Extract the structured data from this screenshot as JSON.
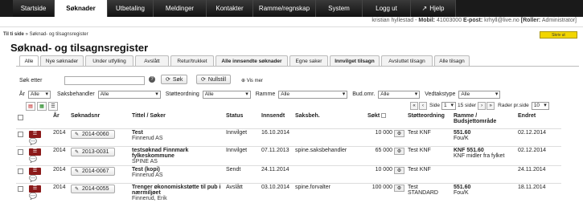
{
  "nav": {
    "tabs": [
      "Startside",
      "Søknader",
      "Utbetaling",
      "Meldinger",
      "Kontakter",
      "Ramme/regnskap",
      "System",
      "Logg ut",
      "Hjelp"
    ],
    "active": "Søknader"
  },
  "user": {
    "name": "kristian hyllestad",
    "mobile_label": "Mobil:",
    "mobile": "41003000",
    "email_label": "E-post:",
    "email": "krhyll@live.no",
    "roles_label": "[Roller:",
    "roles": "Administrator]"
  },
  "breadcrumb": {
    "home": "Til ti side",
    "sep": "»",
    "current": "Søknad- og tilsagnsregister"
  },
  "yellow_button": "Skriv ut",
  "page_title": "Søknad- og tilsagnsregister",
  "tabs": [
    "Alle",
    "Nye søknader",
    "Under utfylling",
    "Avslått",
    "Retur/trukket",
    "Alle innsendte søknader",
    "Egne saker",
    "Innvilget tilsagn",
    "Avsluttet tilsagn",
    "Alle tilsagn"
  ],
  "search": {
    "label": "Søk etter",
    "value": "",
    "search_button": "Søk",
    "reset_button": "Nullstill",
    "more": "Vis mer"
  },
  "filters": [
    {
      "label": "År",
      "value": "Alle"
    },
    {
      "label": "Saksbehandler",
      "value": "Alle"
    },
    {
      "label": "Støtteordning",
      "value": "Alle"
    },
    {
      "label": "Ramme",
      "value": "Alle"
    },
    {
      "label": "Bud.omr.",
      "value": "Alle"
    },
    {
      "label": "Vedtakstype",
      "value": "Alle"
    }
  ],
  "pager": {
    "page_label": "Side",
    "page": "1",
    "of": "15 sider",
    "rows_label": "Rader pr.side",
    "rows": "10"
  },
  "columns": [
    "År",
    "Søknadsnr",
    "Tittel / Søker",
    "Status",
    "Innsendt",
    "Saksbeh.",
    "Søkt",
    "Støtteordning",
    "Ramme / Budsjettområde",
    "Endret"
  ],
  "rows": [
    {
      "year": "2014",
      "nr": "2014-0060",
      "title": "Test",
      "applicant": "Finnerud AS",
      "status": "Innvilget",
      "sent": "16.10.2014",
      "handler": "",
      "amount": "10 000",
      "scheme": "Test KNF",
      "scheme2": "",
      "frame": "551.60",
      "area": "Fou/K",
      "changed": "02.12.2014",
      "bubbles": "1"
    },
    {
      "year": "2014",
      "nr": "2013-0031",
      "title": "testsøknad Finnmark fylkeskommune",
      "applicant": "SPINE AS",
      "status": "Innvilget",
      "sent": "07.11.2013",
      "handler": "spine.saksbehandler",
      "amount": "65 000",
      "scheme": "Test KNF",
      "scheme2": "",
      "frame": "KNF 551.60",
      "area": "KNF midler fra fylket",
      "changed": "02.12.2014",
      "bubbles": "2"
    },
    {
      "year": "2014",
      "nr": "2014-0067",
      "title": "Test (kopi)",
      "applicant": "Finnerud AS",
      "status": "Sendt",
      "sent": "24.11.2014",
      "handler": "",
      "amount": "10 000",
      "scheme": "Test KNF",
      "scheme2": "",
      "frame": "",
      "area": "",
      "changed": "24.11.2014",
      "bubbles": "1"
    },
    {
      "year": "2014",
      "nr": "2014-0055",
      "title": "Trenger økonomiskstøtte til pub i nærmiljøet",
      "applicant": "Finnerud, Erik",
      "status": "Avslått",
      "sent": "03.10.2014",
      "handler": "spine.forvalter",
      "amount": "100 000",
      "scheme": "Test",
      "scheme2": "STANDARD",
      "frame": "551.60",
      "area": "Fou/K",
      "changed": "18.11.2014",
      "bubbles": "1"
    }
  ]
}
